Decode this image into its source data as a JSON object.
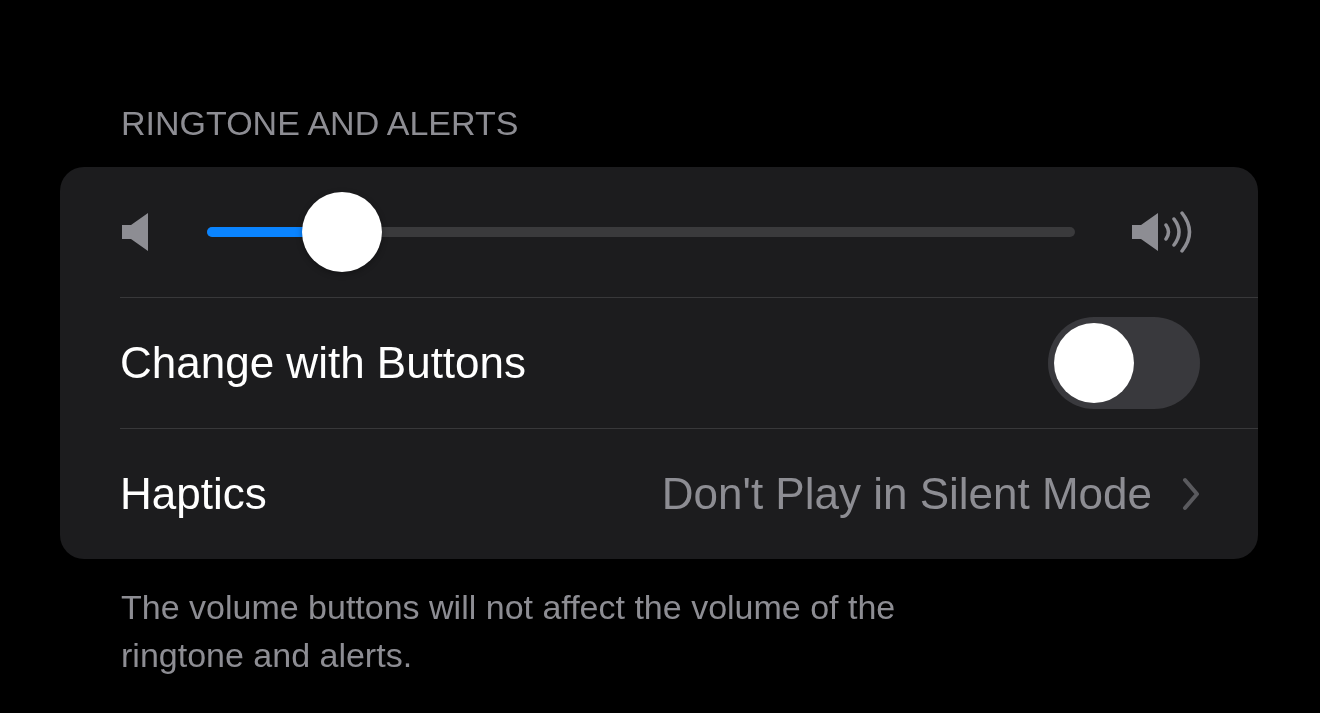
{
  "section": {
    "header": "RINGTONE AND ALERTS",
    "volume": {
      "level": 0.156
    },
    "rows": [
      {
        "kind": "toggle",
        "label": "Change with Buttons",
        "on": false
      },
      {
        "kind": "link",
        "label": "Haptics",
        "value": "Don't Play in Silent Mode"
      }
    ],
    "footer": "The volume buttons will not affect the volume of the ringtone and alerts."
  }
}
